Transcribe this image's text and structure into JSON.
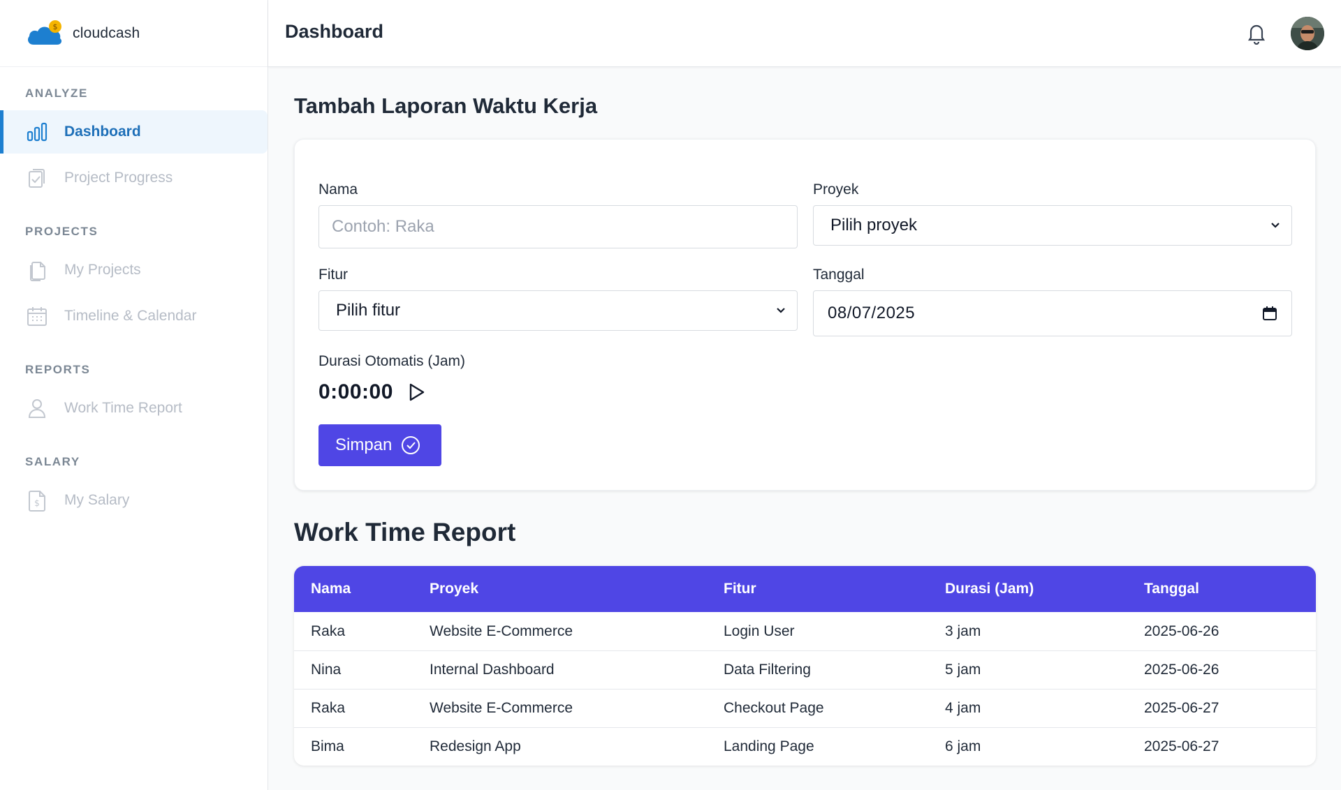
{
  "brand": {
    "name": "cloudcash"
  },
  "colors": {
    "accent": "#4f46e5",
    "sidebar_active": "#1d6fb8",
    "logo_cloud": "#1d7fd0",
    "logo_coin": "#f5b400"
  },
  "sidebar": {
    "sections": [
      {
        "label": "ANALYZE",
        "items": [
          {
            "label": "Dashboard",
            "icon": "bar-chart-icon",
            "active": true
          },
          {
            "label": "Project Progress",
            "icon": "clipboard-check-icon"
          }
        ]
      },
      {
        "label": "PROJECTS",
        "items": [
          {
            "label": "My Projects",
            "icon": "documents-icon"
          },
          {
            "label": "Timeline & Calendar",
            "icon": "calendar-icon"
          }
        ]
      },
      {
        "label": "REPORTS",
        "items": [
          {
            "label": "Work Time Report",
            "icon": "user-icon"
          }
        ]
      },
      {
        "label": "SALARY",
        "items": [
          {
            "label": "My Salary",
            "icon": "salary-document-icon"
          }
        ]
      }
    ]
  },
  "header": {
    "title": "Dashboard",
    "icons": [
      "bell-icon",
      "avatar"
    ]
  },
  "form": {
    "title": "Tambah Laporan Waktu Kerja",
    "nama_label": "Nama",
    "nama_placeholder": "Contoh: Raka",
    "proyek_label": "Proyek",
    "proyek_value": "Pilih proyek",
    "fitur_label": "Fitur",
    "fitur_value": "Pilih fitur",
    "tanggal_label": "Tanggal",
    "tanggal_value": "08/07/2025",
    "durasi_label": "Durasi Otomatis (Jam)",
    "timer_value": "0:00:00",
    "save_label": "Simpan"
  },
  "report": {
    "title": "Work Time Report",
    "columns": [
      "Nama",
      "Proyek",
      "Fitur",
      "Durasi (Jam)",
      "Tanggal"
    ],
    "rows": [
      [
        "Raka",
        "Website E-Commerce",
        "Login User",
        "3 jam",
        "2025-06-26"
      ],
      [
        "Nina",
        "Internal Dashboard",
        "Data Filtering",
        "5 jam",
        "2025-06-26"
      ],
      [
        "Raka",
        "Website E-Commerce",
        "Checkout Page",
        "4 jam",
        "2025-06-27"
      ],
      [
        "Bima",
        "Redesign App",
        "Landing Page",
        "6 jam",
        "2025-06-27"
      ]
    ]
  }
}
